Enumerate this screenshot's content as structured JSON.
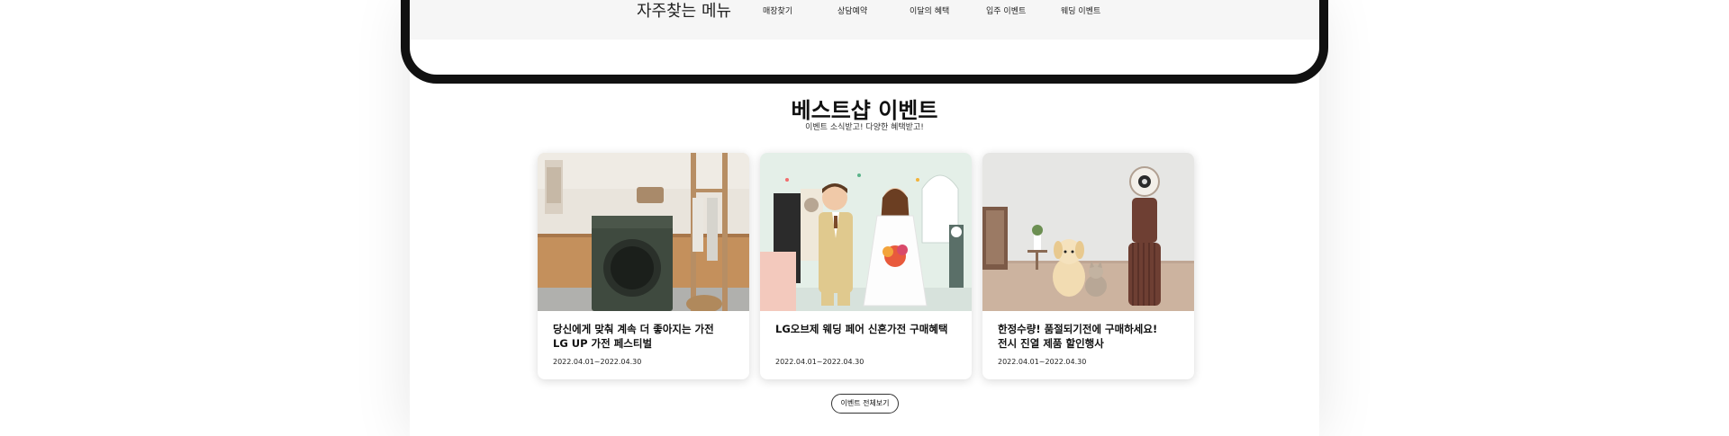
{
  "quick_menu": {
    "title": "자주찾는 메뉴",
    "items": [
      {
        "label": "매장찾기"
      },
      {
        "label": "상담예약"
      },
      {
        "label": "이달의 혜택"
      },
      {
        "label": "입주 이벤트"
      },
      {
        "label": "웨딩 이벤트"
      }
    ]
  },
  "events": {
    "title": "베스트샵 이벤트",
    "subtitle": "이벤트 소식받고! 다양한 혜택받고!",
    "cards": [
      {
        "title_line1": "당신에게 맞춰 계속 더 좋아지는 가전",
        "title_line2": "LG UP 가전 페스티벌",
        "date": "2022.04.01~2022.04.30"
      },
      {
        "title_line1": "LG오브제 웨딩 페어 신혼가전 구매혜택",
        "title_line2": "",
        "date": "2022.04.01~2022.04.30"
      },
      {
        "title_line1": "한정수량! 품절되기전에 구매하세요!",
        "title_line2": "전시 진열 제품 할인행사",
        "date": "2022.04.01~2022.04.30"
      }
    ],
    "more_label": "이벤트 전체보기"
  },
  "colors": {
    "phone_frame": "#111111",
    "quick_bar_bg": "#f6f6f6",
    "card_bg": "#ffffff"
  }
}
